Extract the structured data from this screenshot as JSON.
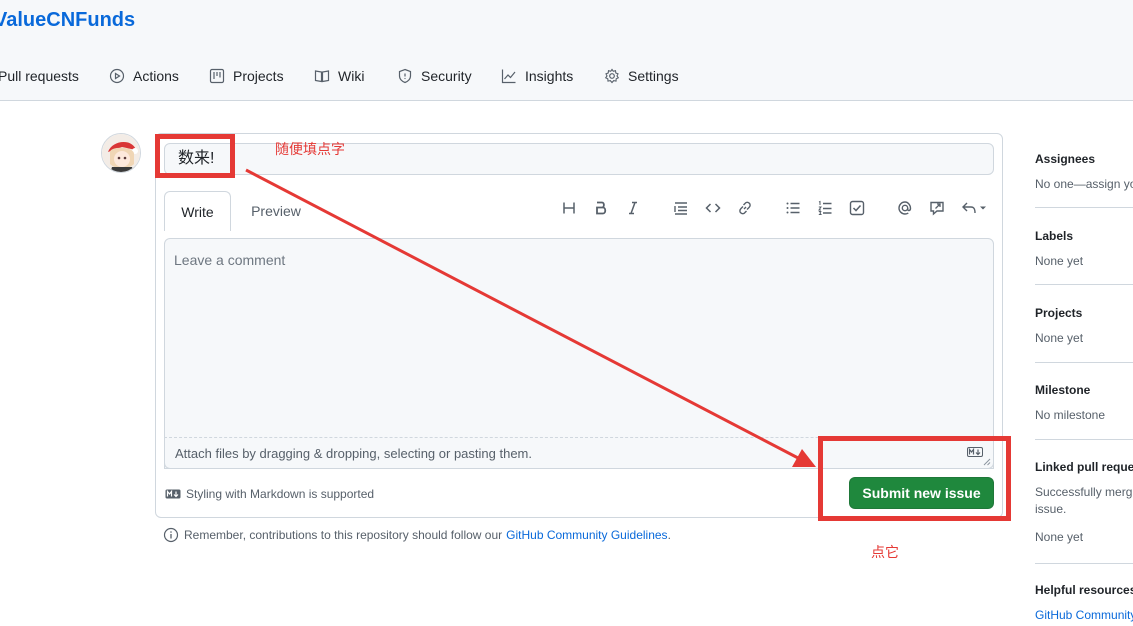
{
  "repo": {
    "title": "ValueCNFunds"
  },
  "nav": [
    {
      "label": "Pull requests",
      "icon": "pull-request-icon"
    },
    {
      "label": "Actions",
      "icon": "play-icon"
    },
    {
      "label": "Projects",
      "icon": "project-icon"
    },
    {
      "label": "Wiki",
      "icon": "book-icon"
    },
    {
      "label": "Security",
      "icon": "shield-icon"
    },
    {
      "label": "Insights",
      "icon": "graph-icon"
    },
    {
      "label": "Settings",
      "icon": "gear-icon"
    }
  ],
  "issue_form": {
    "title_value": "数来!",
    "tabs": [
      {
        "label": "Write"
      },
      {
        "label": "Preview"
      }
    ],
    "toolbar_icons": [
      "heading-icon",
      "bold-icon",
      "italic-icon",
      "quote-icon",
      "code-icon",
      "link-icon",
      "bullet-list-icon",
      "numbered-list-icon",
      "task-list-icon",
      "mention-icon",
      "reference-icon",
      "reply-icon"
    ],
    "comment_placeholder": "Leave a comment",
    "attach_text": "Attach files by dragging & dropping, selecting or pasting them.",
    "markdown_note": "Styling with Markdown is supported",
    "submit_label": "Submit new issue"
  },
  "guideline": {
    "text": "Remember, contributions to this repository should follow our",
    "link": "GitHub Community Guidelines",
    "suffix": "."
  },
  "sidebar": [
    {
      "title": "Assignees",
      "value": "No one—assign yo"
    },
    {
      "title": "Labels",
      "value": "None yet"
    },
    {
      "title": "Projects",
      "value": "None yet"
    },
    {
      "title": "Milestone",
      "value": "No milestone"
    },
    {
      "title": "Linked pull reque",
      "value": "Successfully mergi",
      "value2": "issue.",
      "value3": "None yet"
    },
    {
      "title": "Helpful resources",
      "link": "GitHub Community"
    }
  ],
  "annotations": {
    "title_hint": "随便填点字",
    "submit_hint": "点它",
    "color": "#e53935"
  },
  "colors": {
    "accent": "#0969da",
    "submit": "#1f883d"
  }
}
